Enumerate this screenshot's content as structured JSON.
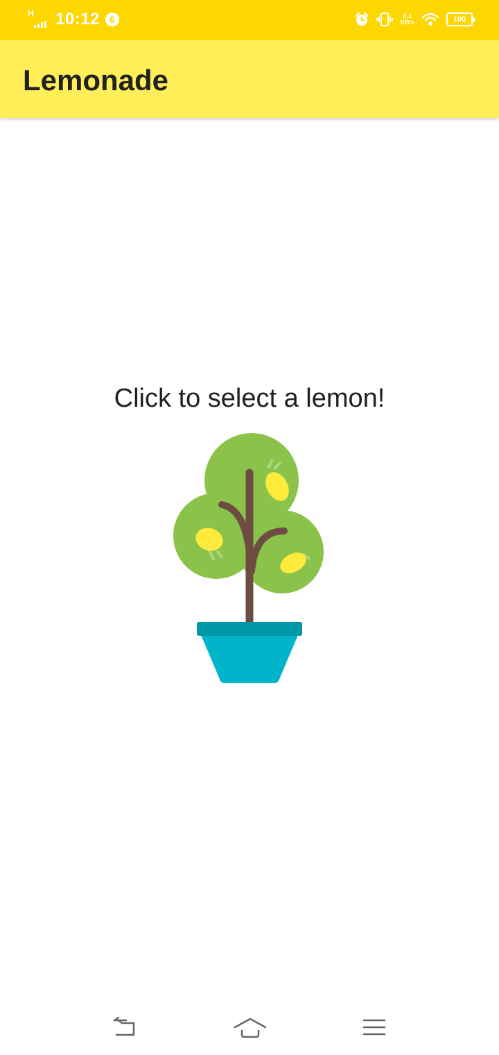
{
  "status_bar": {
    "network_type": "H",
    "time": "10:12",
    "notification_count": "6",
    "net_speed_value": "0.1",
    "net_speed_unit": "KB/s",
    "battery_level": "100",
    "icons": [
      "signal-icon",
      "alarm-icon",
      "vibrate-icon",
      "wifi-icon",
      "battery-icon"
    ]
  },
  "app_bar": {
    "title": "Lemonade"
  },
  "main": {
    "prompt": "Click to select a lemon!",
    "image": "lemon-tree-icon"
  },
  "nav_bar": {
    "icons": [
      "back-icon",
      "home-icon",
      "menu-icon"
    ]
  },
  "colors": {
    "status_bar": "#FFD700",
    "app_bar": "#FFEE58",
    "tree_green": "#8BC34A",
    "trunk": "#6D4C41",
    "lemon": "#FFEB3B",
    "pot": "#00B4CB",
    "pot_rim": "#0097A7"
  }
}
